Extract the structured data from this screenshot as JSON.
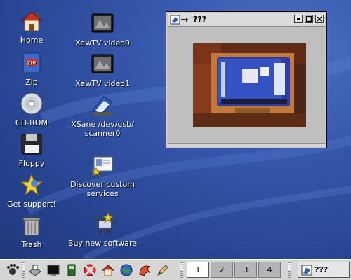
{
  "desktop": {
    "icons": [
      {
        "label": "Home",
        "icon": "home-icon"
      },
      {
        "label": "Zip",
        "icon": "zip-disk-icon"
      },
      {
        "label": "CD-ROM",
        "icon": "cdrom-icon"
      },
      {
        "label": "Floppy",
        "icon": "floppy-icon"
      },
      {
        "label": "Get support!",
        "icon": "support-star-icon"
      },
      {
        "label": "Trash",
        "icon": "trash-icon"
      },
      {
        "label": "XawTV video0",
        "icon": "tv-icon"
      },
      {
        "label": "XawTV video1",
        "icon": "tv-icon"
      },
      {
        "label": "XSane /dev/usb/\nscanner0",
        "icon": "scanner-icon"
      },
      {
        "label": "Discover custom\nservices",
        "icon": "services-card-icon"
      },
      {
        "label": "Buy new software",
        "icon": "shopping-cart-icon"
      }
    ]
  },
  "window": {
    "title": "???",
    "buttons": [
      "minimize",
      "maximize",
      "close"
    ]
  },
  "taskbar": {
    "launchers": [
      "gnome-foot-icon",
      "printer-icon",
      "terminal-icon",
      "phone-icon",
      "lifebuoy-icon",
      "home-icon",
      "globe-icon",
      "mozilla-icon",
      "pencil-icon"
    ],
    "pager": [
      "1",
      "2",
      "3",
      "4"
    ],
    "active_workspace": "1",
    "task_title": "???"
  },
  "colors": {
    "desktop": "#3657ad",
    "panel": "#d6d6d6"
  }
}
